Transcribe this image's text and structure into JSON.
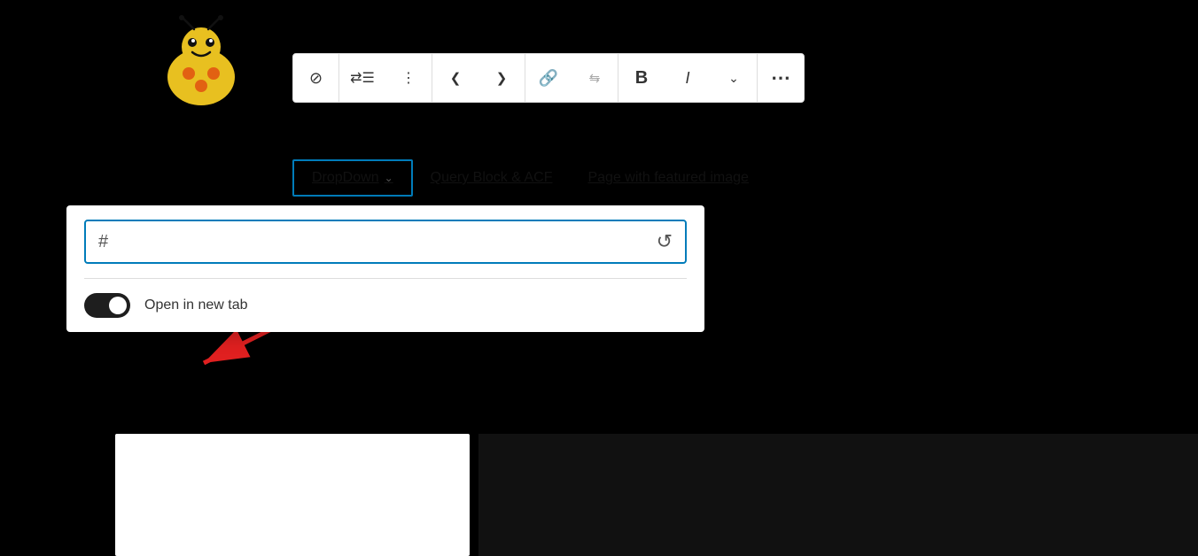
{
  "logo": {
    "alt": "Ladybug logo"
  },
  "toolbar": {
    "buttons": [
      {
        "id": "navigate",
        "label": "⊘",
        "title": "Navigate"
      },
      {
        "id": "list-indent",
        "label": "⇇",
        "title": "List indent"
      },
      {
        "id": "drag-handle",
        "label": "⠿",
        "title": "Drag"
      },
      {
        "id": "prev",
        "label": "<",
        "title": "Previous"
      },
      {
        "id": "next",
        "label": ">",
        "title": "Next"
      },
      {
        "id": "link",
        "label": "⌁",
        "title": "Link"
      },
      {
        "id": "unlink",
        "label": "⌁̶",
        "title": "Unlink"
      },
      {
        "id": "bold",
        "label": "B",
        "title": "Bold"
      },
      {
        "id": "italic",
        "label": "I",
        "title": "Italic"
      },
      {
        "id": "more-text",
        "label": "∨",
        "title": "More"
      },
      {
        "id": "options",
        "label": "⋯",
        "title": "Options"
      }
    ]
  },
  "nav": {
    "tabs": [
      {
        "id": "dropdown",
        "label": "DropDown",
        "active": true,
        "has_chevron": true
      },
      {
        "id": "query-block",
        "label": "Query Block & ACF",
        "active": false
      },
      {
        "id": "featured-image",
        "label": "Page with featured image",
        "active": false
      }
    ]
  },
  "dropdown_popup": {
    "url_input": {
      "prefix": "#",
      "value": "",
      "placeholder": ""
    },
    "reset_button_label": "↺",
    "new_tab": {
      "label": "Open in new tab",
      "enabled": true
    }
  },
  "arrow": {
    "color": "#e02020"
  }
}
